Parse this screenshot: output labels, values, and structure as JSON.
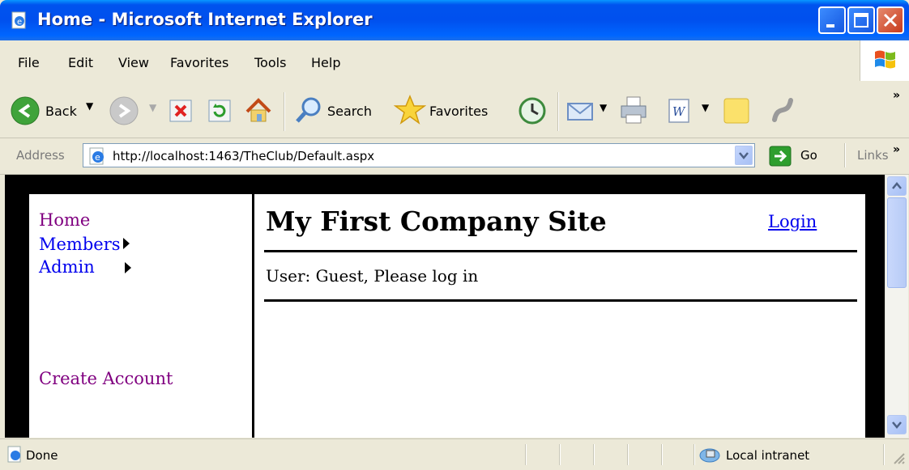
{
  "window": {
    "title": "Home - Microsoft Internet Explorer"
  },
  "menu": [
    "File",
    "Edit",
    "View",
    "Favorites",
    "Tools",
    "Help"
  ],
  "toolbar": {
    "back_label": "Back",
    "search_label": "Search",
    "favorites_label": "Favorites"
  },
  "address": {
    "label": "Address",
    "url": "http://localhost:1463/TheClub/Default.aspx",
    "go_label": "Go",
    "links_label": "Links"
  },
  "page": {
    "nav": {
      "home": "Home",
      "members": "Members",
      "admin": "Admin",
      "create_account": "Create Account"
    },
    "site_title": "My First Company Site",
    "login_label": "Login",
    "user_status": "User: Guest, Please log in"
  },
  "status": {
    "text": "Done",
    "zone": "Local intranet"
  },
  "colors": {
    "titlebar": "#0053ee",
    "visited_link": "#800080",
    "link": "#0000ee"
  }
}
